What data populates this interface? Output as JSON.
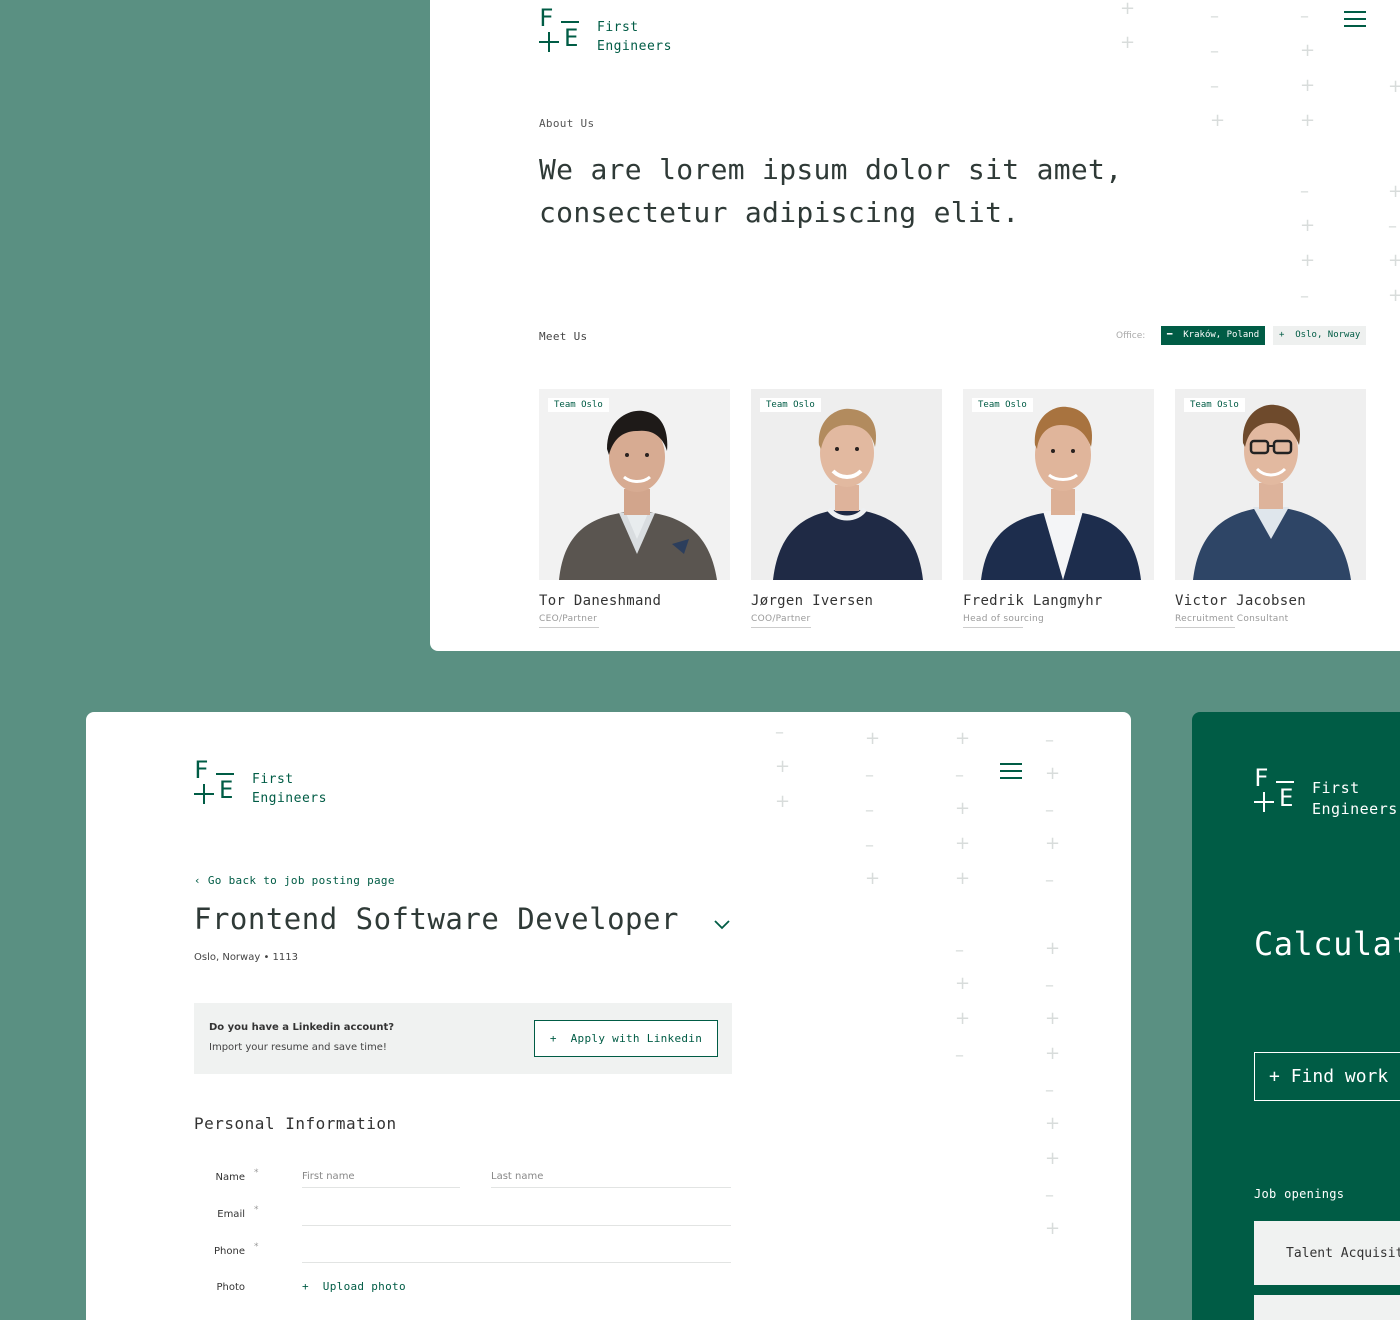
{
  "brand": {
    "line1": "First",
    "line2": "Engineers"
  },
  "about": {
    "label": "About Us",
    "headline": "We are lorem ipsum dolor sit amet, consectetur adipiscing elit."
  },
  "meet": {
    "label": "Meet Us",
    "office_label": "Office:",
    "offices": [
      {
        "label": "Kraków, Poland",
        "icon": "minus-icon",
        "active": true
      },
      {
        "label": "Oslo, Norway",
        "icon": "plus-icon",
        "active": false
      }
    ],
    "team": [
      {
        "tag": "Team Oslo",
        "name": "Tor Daneshmand",
        "role": "CEO/Partner"
      },
      {
        "tag": "Team Oslo",
        "name": "Jørgen Iversen",
        "role": "COO/Partner"
      },
      {
        "tag": "Team Oslo",
        "name": "Fredrik Langmyhr",
        "role": "Head of sourcing"
      },
      {
        "tag": "Team Oslo",
        "name": "Victor Jacobsen",
        "role": "Recruitment Consultant"
      }
    ]
  },
  "job": {
    "back_link": "‹ Go back to job posting page",
    "title": "Frontend Software Developer",
    "location": "Oslo, Norway",
    "id": "1113",
    "linkedin": {
      "question": "Do you have a Linkedin account?",
      "subtext": "Import your resume and save time!",
      "button": "Apply with Linkedin"
    },
    "section_title": "Personal Information",
    "fields": {
      "name_label": "Name",
      "first_name_placeholder": "First name",
      "last_name_placeholder": "Last name",
      "email_label": "Email",
      "phone_label": "Phone",
      "photo_label": "Photo",
      "required_mark": "*",
      "upload_label": "Upload photo"
    }
  },
  "green_panel": {
    "heading": "Calculat",
    "find_button": "Find work",
    "job_openings_label": "Job openings",
    "jobs": [
      "Talent Acquisit",
      ""
    ]
  },
  "colors": {
    "brand_green": "#005c45",
    "background": "#5a9082"
  }
}
